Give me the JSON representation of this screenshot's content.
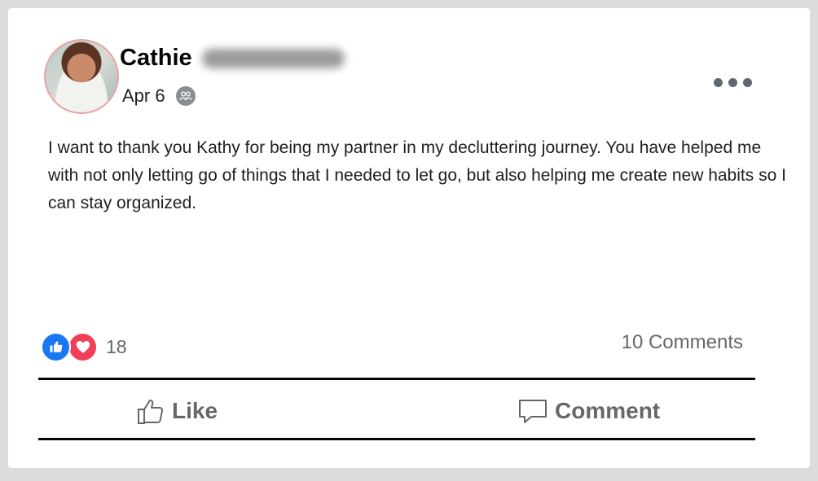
{
  "post": {
    "author": "Cathie",
    "date": "Apr 6",
    "audience_icon": "friends-icon",
    "more_icon": "more-horizontal-icon",
    "text": "I want to thank you Kathy for being my partner in my decluttering journey. You have helped me with not only letting go of things that I needed to let go, but also helping me create new habits so I can stay organized."
  },
  "reactions": {
    "types": [
      "like",
      "love"
    ],
    "count": "18",
    "like_color": "#1877f2",
    "love_color": "#f33e58"
  },
  "comments_count": "10 Comments",
  "actions": {
    "like_label": "Like",
    "comment_label": "Comment"
  },
  "colors": {
    "text": "#1c1e21",
    "muted": "#65676b",
    "background": "#dcdcdc"
  }
}
